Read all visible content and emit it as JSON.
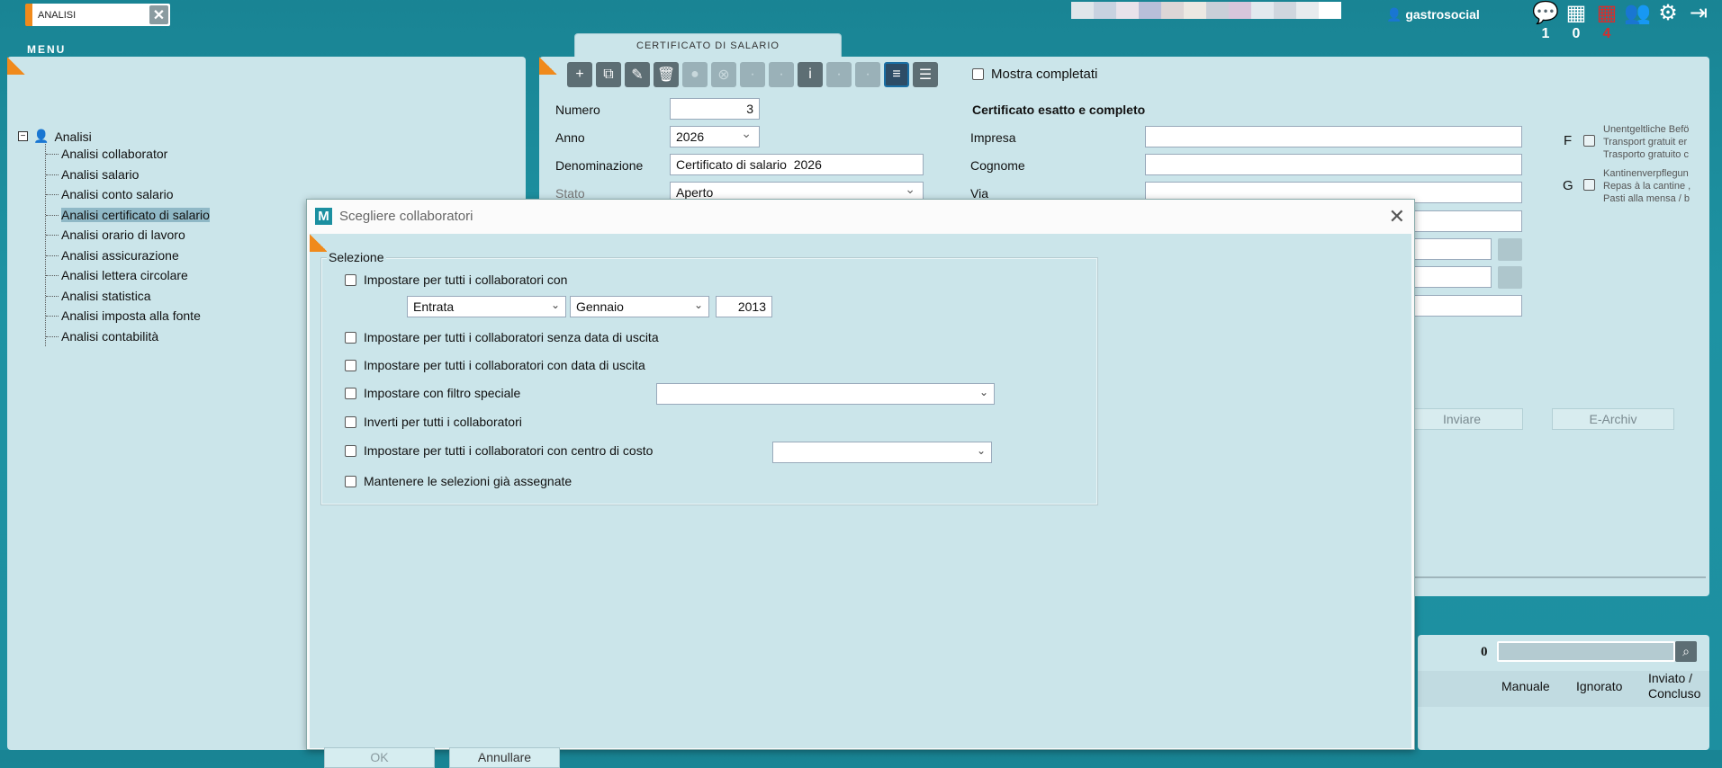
{
  "topbar": {
    "search_value": "ANALISI",
    "menu_label": "MENU",
    "user": "gastrosocial",
    "icons": [
      {
        "name": "chat-icon",
        "glyph": "💬",
        "count": "1"
      },
      {
        "name": "calendar-icon",
        "glyph": "📅",
        "count": "0"
      },
      {
        "name": "calendar-alert-icon",
        "glyph": "📅",
        "count": "4"
      },
      {
        "name": "group-icon",
        "glyph": "👥",
        "count": ""
      },
      {
        "name": "gear-icon",
        "glyph": "⚙",
        "count": ""
      },
      {
        "name": "logout-icon",
        "glyph": "⇥",
        "count": ""
      }
    ]
  },
  "tree": {
    "root": "Analisi",
    "items": [
      "Analisi collaborator",
      "Analisi salario",
      "Analisi conto salario",
      "Analisi certificato di salario",
      "Analisi orario di lavoro",
      "Analisi assicurazione",
      "Analisi lettera circolare",
      "Analisi statistica",
      "Analisi imposta alla fonte",
      "Analisi contabilità"
    ],
    "selected_index": 3
  },
  "form": {
    "tab": "CERTIFICATO DI SALARIO",
    "show_completed": "Mostra completati",
    "numero_label": "Numero",
    "numero_value": "3",
    "anno_label": "Anno",
    "anno_value": "2026",
    "denominazione_label": "Denominazione",
    "denominazione_value": "Certificato di salario  2026",
    "stato_label": "Stato",
    "stato_value": "Aperto",
    "complete_heading": "Certificato esatto e completo",
    "impresa_label": "Impresa",
    "cognome_label": "Cognome",
    "via_label": "Via",
    "f_label": "F",
    "g_label": "G",
    "f_text": [
      "Unentgeltliche Befö",
      "Transport gratuit er",
      "Trasporto gratuito c"
    ],
    "g_text": [
      "Kantinenverpflegun",
      "Repas à la cantine ,",
      "Pasti alla mensa / b"
    ],
    "inviare": "Inviare",
    "earchiv": "E-Archiv",
    "count": "0",
    "col_manuale": "Manuale",
    "col_ignorato": "Ignorato",
    "col_inviato": "Inviato / Concluso"
  },
  "modal": {
    "title": "Scegliere collaboratori",
    "legend": "Selezione",
    "opt1": "Impostare per tutti i collaboratori con",
    "opt1_sel1": "Entrata",
    "opt1_sel2": "Gennaio",
    "opt1_year": "2013",
    "opt2": "Impostare per tutti i collaboratori senza data di uscita",
    "opt3": "Impostare per tutti i collaboratori con data di uscita",
    "opt4": "Impostare con filtro speciale",
    "opt5": "Inverti per tutti i collaboratori",
    "opt6": "Impostare per tutti i collaboratori con centro di costo",
    "opt7": "Mantenere le selezioni già assegnate",
    "ok": "OK",
    "cancel": "Annullare"
  }
}
